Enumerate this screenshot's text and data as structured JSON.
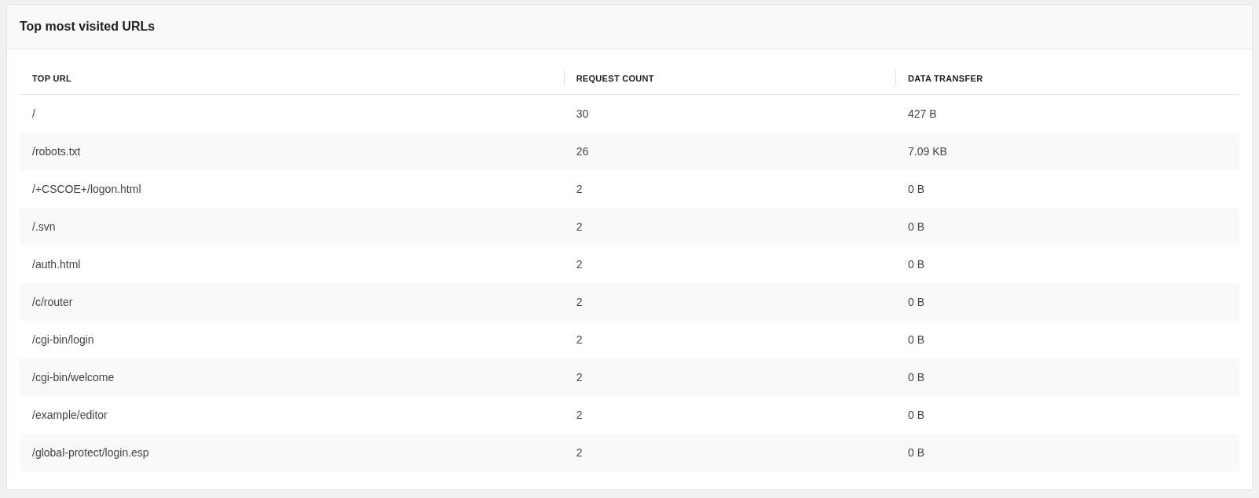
{
  "card": {
    "title": "Top most visited URLs"
  },
  "table": {
    "columns": [
      "TOP URL",
      "REQUEST COUNT",
      "DATA TRANSFER"
    ],
    "rows": [
      [
        "/",
        "30",
        "427 B"
      ],
      [
        "/robots.txt",
        "26",
        "7.09 KB"
      ],
      [
        "/+CSCOE+/logon.html",
        "2",
        "0 B"
      ],
      [
        "/.svn",
        "2",
        "0 B"
      ],
      [
        "/auth.html",
        "2",
        "0 B"
      ],
      [
        "/c/router",
        "2",
        "0 B"
      ],
      [
        "/cgi-bin/login",
        "2",
        "0 B"
      ],
      [
        "/cgi-bin/welcome",
        "2",
        "0 B"
      ],
      [
        "/example/editor",
        "2",
        "0 B"
      ],
      [
        "/global-protect/login.esp",
        "2",
        "0 B"
      ]
    ]
  }
}
